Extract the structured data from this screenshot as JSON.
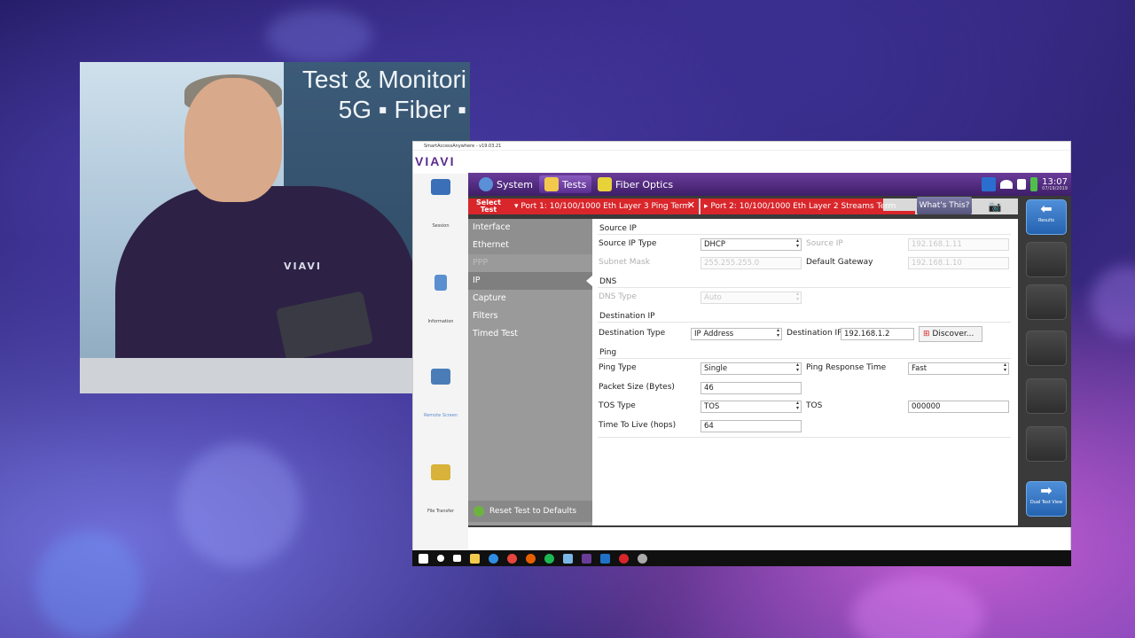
{
  "webcam": {
    "banner_line1": "Test & Monitori",
    "banner_line2": "5G ▪ Fiber ▪",
    "shirt_logo": "VIAVI"
  },
  "window": {
    "title": "SmartAccessAnywhere - v19.03.21",
    "brand": "VIAVI"
  },
  "left_rail": {
    "items": [
      {
        "label": "Session",
        "icon": "monitor-icon",
        "color": "#3b6fb8"
      },
      {
        "label": "Information",
        "icon": "info-icon",
        "color": "#5a8fd0"
      },
      {
        "label": "Remote Screen",
        "icon": "remote-screen-icon",
        "color": "#4a7db8"
      },
      {
        "label": "File Transfer",
        "icon": "folder-icon",
        "color": "#d8b23a"
      }
    ]
  },
  "nav": {
    "system": "System",
    "tests": "Tests",
    "fiber_optics": "Fiber Optics",
    "clock_time": "13:07",
    "clock_date": "07/19/2019",
    "status_icons": [
      "v2-icon",
      "wifi-icon",
      "volume-icon",
      "battery-icon"
    ]
  },
  "port_bar": {
    "select_test": "Select\nTest",
    "port1": "▾ Port 1: 10/100/1000 Eth Layer 3 Ping Term",
    "port2": "▸ Port 2: 10/100/1000 Eth Layer 2 Streams Term",
    "whats_this": "What's This?",
    "camera": "📷"
  },
  "menu": {
    "items": [
      {
        "label": "Interface",
        "state": "top"
      },
      {
        "label": "Ethernet",
        "state": "top"
      },
      {
        "label": "PPP",
        "state": "dim"
      },
      {
        "label": "IP",
        "state": "sel"
      },
      {
        "label": "Capture",
        "state": "normal"
      },
      {
        "label": "Filters",
        "state": "normal"
      },
      {
        "label": "Timed Test",
        "state": "normal"
      }
    ],
    "reset": "Reset Test to Defaults"
  },
  "form": {
    "source_ip_head": "Source IP",
    "source_ip_type_label": "Source IP Type",
    "source_ip_type_value": "DHCP",
    "source_ip_label": "Source IP",
    "source_ip_value": "192.168.1.11",
    "subnet_mask_label": "Subnet Mask",
    "subnet_mask_value": "255.255.255.0",
    "default_gateway_label": "Default Gateway",
    "default_gateway_value": "192.168.1.10",
    "dns_head": "DNS",
    "dns_type_label": "DNS Type",
    "dns_type_value": "Auto",
    "dest_ip_head": "Destination IP",
    "dest_type_label": "Destination Type",
    "dest_type_value": "IP Address",
    "dest_ip_label": "Destination IP",
    "dest_ip_value": "192.168.1.2",
    "discover": "Discover...",
    "ping_head": "Ping",
    "ping_type_label": "Ping Type",
    "ping_type_value": "Single",
    "ping_resp_label": "Ping Response Time",
    "ping_resp_value": "Fast",
    "packet_size_label": "Packet Size (Bytes)",
    "packet_size_value": "46",
    "tos_type_label": "TOS Type",
    "tos_type_value": "TOS",
    "tos_label": "TOS",
    "tos_value": "000000",
    "ttl_label": "Time To Live (hops)",
    "ttl_value": "64"
  },
  "right_rail": {
    "results": "Results",
    "dual_test_view": "Dual Test View"
  },
  "taskbar": {
    "icons": [
      {
        "name": "windows-start-icon",
        "color": "#ffffff"
      },
      {
        "name": "search-icon",
        "color": "#ffffff"
      },
      {
        "name": "task-view-icon",
        "color": "#ffffff"
      },
      {
        "name": "file-explorer-icon",
        "color": "#f2c94c"
      },
      {
        "name": "edge-icon",
        "color": "#2f8de4"
      },
      {
        "name": "chrome-icon",
        "color": "#e8453c"
      },
      {
        "name": "firefox-icon",
        "color": "#e66000"
      },
      {
        "name": "spotify-icon",
        "color": "#1db954"
      },
      {
        "name": "app-icon",
        "color": "#7ab7e8"
      },
      {
        "name": "smartaccess-icon",
        "color": "#6a3c9a"
      },
      {
        "name": "outlook-icon",
        "color": "#1e73c8"
      },
      {
        "name": "red-app-icon",
        "color": "#d8262b"
      },
      {
        "name": "settings-icon",
        "color": "#aaaaaa"
      }
    ]
  }
}
